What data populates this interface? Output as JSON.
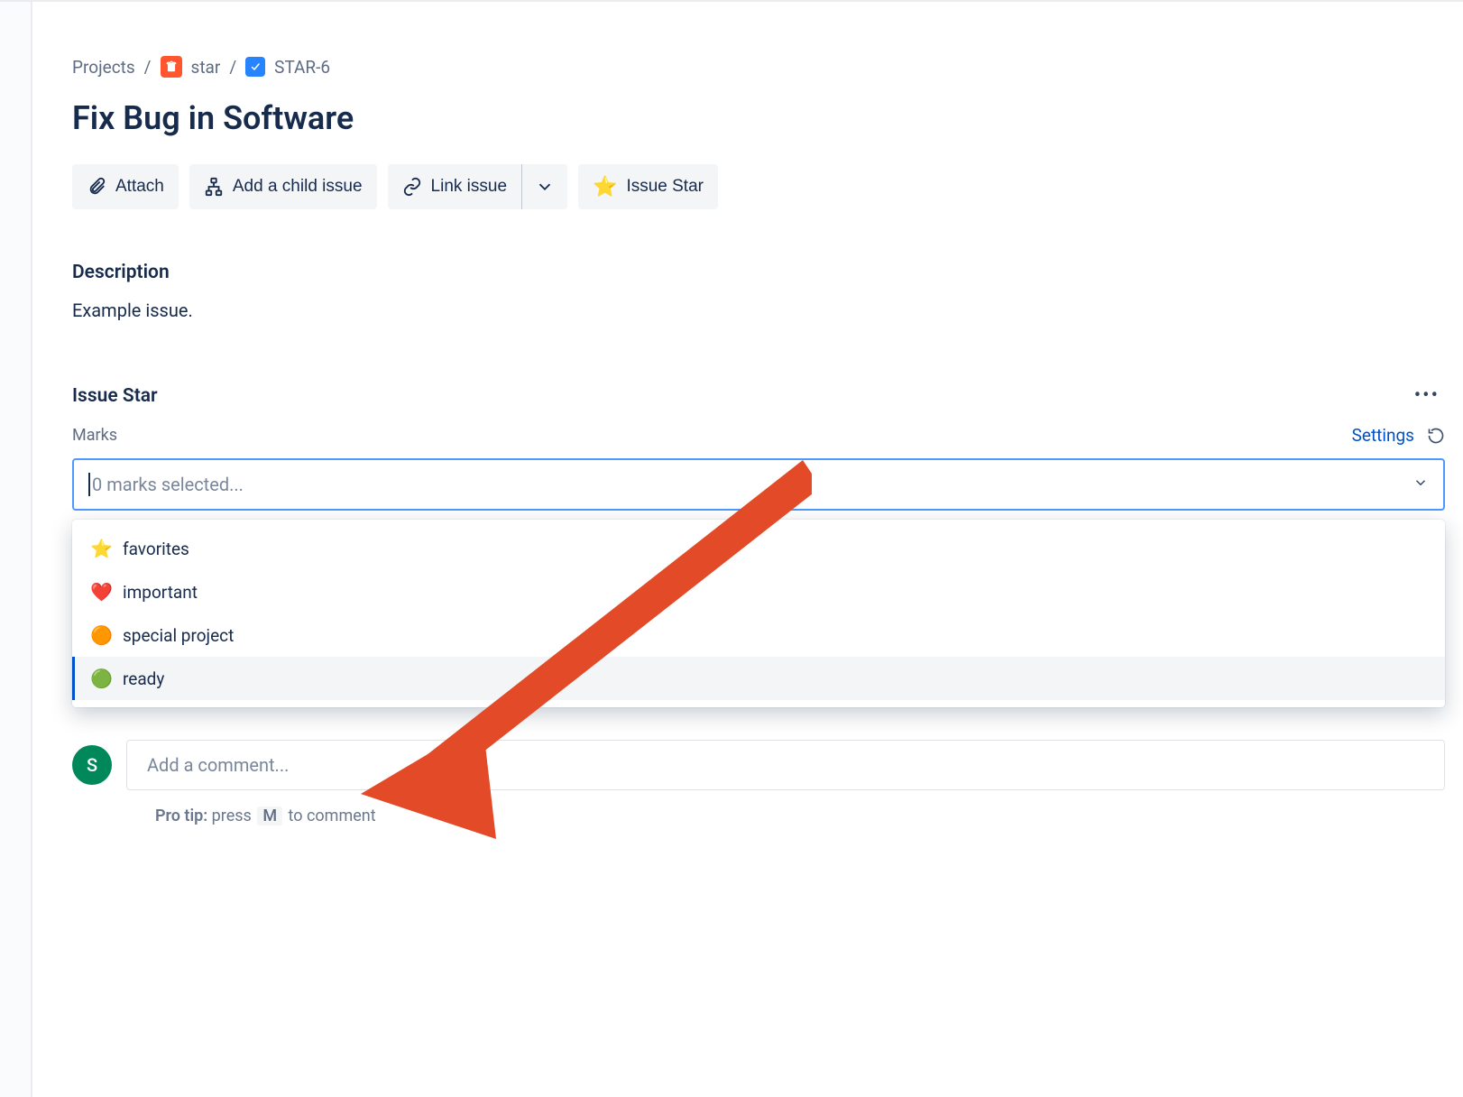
{
  "breadcrumb": {
    "root": "Projects",
    "project": "star",
    "issue_key": "STAR-6"
  },
  "issue": {
    "title": "Fix Bug in Software",
    "description_label": "Description",
    "description_body": "Example issue."
  },
  "actions": {
    "attach": "Attach",
    "add_child": "Add a child issue",
    "link": "Link issue",
    "issue_star": "Issue Star"
  },
  "panel": {
    "title": "Issue Star",
    "marks_label": "Marks",
    "settings": "Settings",
    "placeholder": "0 marks selected...",
    "options": [
      {
        "emoji": "⭐",
        "label": "favorites"
      },
      {
        "emoji": "❤️",
        "label": "important"
      },
      {
        "emoji": "🟠",
        "label": "special project"
      },
      {
        "emoji": "🟢",
        "label": "ready"
      }
    ]
  },
  "comment": {
    "avatar_initial": "S",
    "placeholder": "Add a comment...",
    "protip_prefix": "Pro tip:",
    "protip_press": "press",
    "protip_key": "M",
    "protip_suffix": "to comment"
  }
}
